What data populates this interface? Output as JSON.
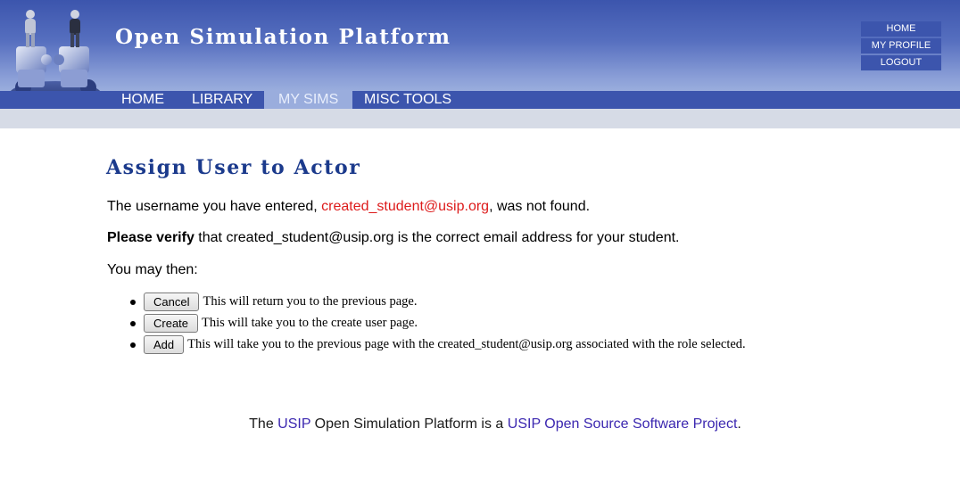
{
  "header": {
    "site_title": "Open Simulation Platform",
    "top_links": [
      "HOME",
      "MY PROFILE",
      "LOGOUT"
    ]
  },
  "nav": {
    "items": [
      "HOME",
      "LIBRARY",
      "MY SIMS",
      "MISC TOOLS"
    ],
    "active": "MY SIMS"
  },
  "main": {
    "title": "Assign User to Actor",
    "not_found_prefix": "The username you have entered, ",
    "username": "created_student@usip.org",
    "not_found_suffix": ", was not found.",
    "verify_bold": "Please verify",
    "verify_rest": " that created_student@usip.org is the correct email address for your student.",
    "then_text": "You may then:",
    "options": [
      {
        "button": "Cancel",
        "desc": "This will return you to the previous page."
      },
      {
        "button": "Create",
        "desc": "This will take you to the create user page."
      },
      {
        "button": "Add",
        "desc": "This will take you to the previous page with the created_student@usip.org associated with the role selected."
      }
    ]
  },
  "footer": {
    "prefix": "The ",
    "usip_link": "USIP",
    "middle": " Open Simulation Platform is a ",
    "project_link": "USIP Open Source Software Project",
    "suffix": "."
  },
  "colors": {
    "header_blue": "#3c55ad",
    "title_blue": "#1b3a8c",
    "error_red": "#dd1b1b",
    "link_purple": "#3b27b0"
  }
}
